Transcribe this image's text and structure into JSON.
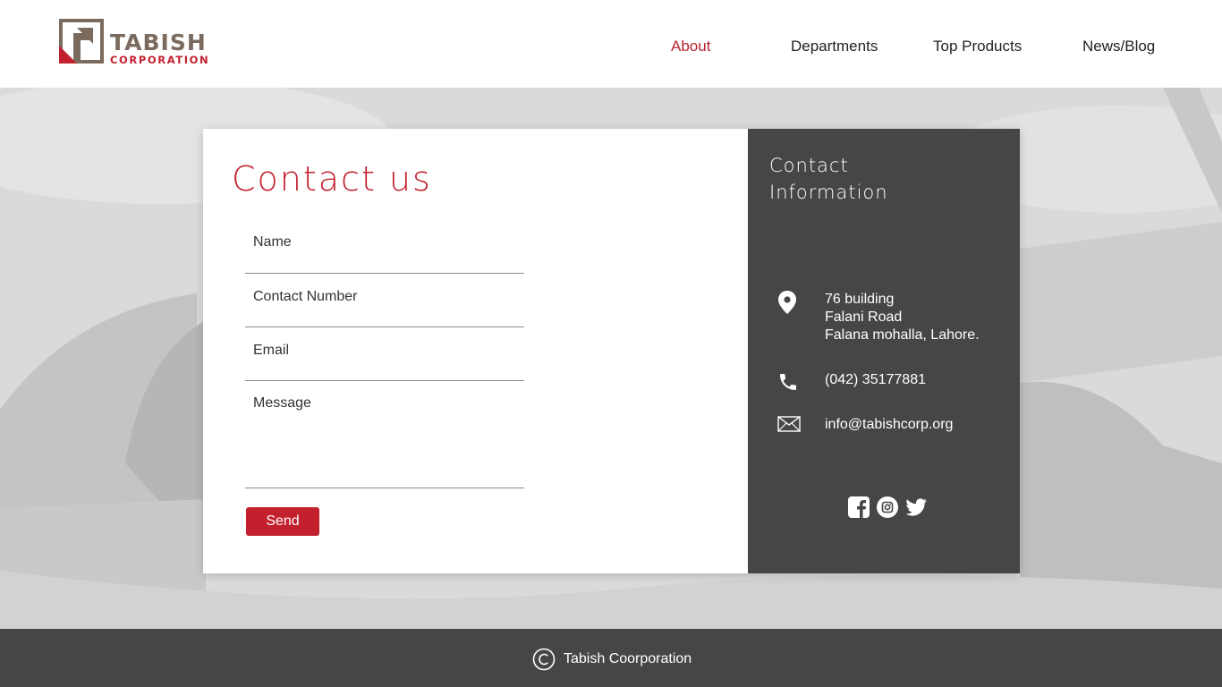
{
  "brand": {
    "name": "TABISH",
    "sub": "CORPORATION"
  },
  "nav": {
    "items": [
      {
        "label": "About",
        "active": true
      },
      {
        "label": "Departments",
        "active": false
      },
      {
        "label": "Top Products",
        "active": false
      },
      {
        "label": "News/Blog",
        "active": false
      }
    ]
  },
  "form": {
    "title": "Contact us",
    "name_label": "Name",
    "contact_label": "Contact Number",
    "email_label": "Email",
    "message_label": "Message",
    "send_label": "Send"
  },
  "info": {
    "title": "Contact Information",
    "address": [
      "76 building",
      "Falani Road",
      "Falana mohalla, Lahore."
    ],
    "phone": "(042) 35177881",
    "email": "info@tabishcorp.org",
    "icons": [
      "location-pin-icon",
      "phone-icon",
      "mail-icon"
    ],
    "social": [
      "facebook-icon",
      "instagram-icon",
      "twitter-icon"
    ]
  },
  "footer": {
    "copyright": "Tabish Coorporation",
    "icon": "copyright-icon"
  },
  "colors": {
    "accent": "#c3202e",
    "dark_panel": "#464646",
    "logo_brown": "#7a6b5e"
  }
}
